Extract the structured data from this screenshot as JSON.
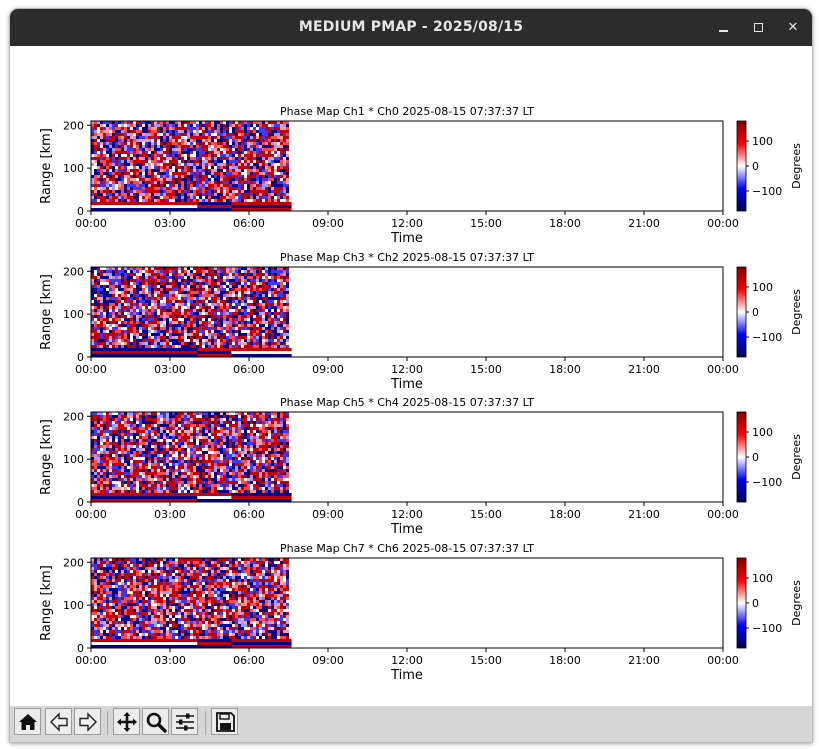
{
  "window": {
    "title": "MEDIUM PMAP - 2025/08/15"
  },
  "toolbar": {
    "buttons": [
      {
        "name": "home-button",
        "icon": "home-icon"
      },
      {
        "name": "back-button",
        "icon": "arrow-left-icon"
      },
      {
        "name": "forward-button",
        "icon": "arrow-right-icon"
      },
      {
        "name": "pan-button",
        "icon": "move-icon"
      },
      {
        "name": "zoom-button",
        "icon": "magnifier-icon"
      },
      {
        "name": "configure-subplots-button",
        "icon": "sliders-icon"
      },
      {
        "name": "save-button",
        "icon": "floppy-disk-icon"
      }
    ]
  },
  "colors": {
    "titlebar": "#2c2c2c",
    "positive": "#b40000",
    "negative": "#00008c",
    "toolbar": "#d6d6d6"
  },
  "chart_data": [
    {
      "type": "heatmap",
      "title": "Phase Map Ch1 * Ch0 2025-08-15 07:37:37 LT",
      "xlabel": "Time",
      "ylabel": "Range [km]",
      "x_ticks": [
        "00:00",
        "03:00",
        "06:00",
        "09:00",
        "12:00",
        "15:00",
        "18:00",
        "21:00",
        "00:00"
      ],
      "y_ticks": [
        0,
        100,
        200
      ],
      "ylim": [
        0,
        210
      ],
      "data_end_time": "07:37",
      "colorbar": {
        "label": "Degrees",
        "ticks": [
          100,
          0,
          -100
        ],
        "range": [
          -180,
          180
        ],
        "colormap": "seismic"
      }
    },
    {
      "type": "heatmap",
      "title": "Phase Map Ch3 * Ch2 2025-08-15 07:37:37 LT",
      "xlabel": "Time",
      "ylabel": "Range [km]",
      "x_ticks": [
        "00:00",
        "03:00",
        "06:00",
        "09:00",
        "12:00",
        "15:00",
        "18:00",
        "21:00",
        "00:00"
      ],
      "y_ticks": [
        0,
        100,
        200
      ],
      "ylim": [
        0,
        210
      ],
      "data_end_time": "07:37",
      "colorbar": {
        "label": "Degrees",
        "ticks": [
          100,
          0,
          -100
        ],
        "range": [
          -180,
          180
        ],
        "colormap": "seismic"
      }
    },
    {
      "type": "heatmap",
      "title": "Phase Map Ch5 * Ch4 2025-08-15 07:37:37 LT",
      "xlabel": "Time",
      "ylabel": "Range [km]",
      "x_ticks": [
        "00:00",
        "03:00",
        "06:00",
        "09:00",
        "12:00",
        "15:00",
        "18:00",
        "21:00",
        "00:00"
      ],
      "y_ticks": [
        0,
        100,
        200
      ],
      "ylim": [
        0,
        210
      ],
      "data_end_time": "07:37",
      "colorbar": {
        "label": "Degrees",
        "ticks": [
          100,
          0,
          -100
        ],
        "range": [
          -180,
          180
        ],
        "colormap": "seismic"
      }
    },
    {
      "type": "heatmap",
      "title": "Phase Map Ch7 * Ch6 2025-08-15 07:37:37 LT",
      "xlabel": "Time",
      "ylabel": "Range [km]",
      "x_ticks": [
        "00:00",
        "03:00",
        "06:00",
        "09:00",
        "12:00",
        "15:00",
        "18:00",
        "21:00",
        "00:00"
      ],
      "y_ticks": [
        0,
        100,
        200
      ],
      "ylim": [
        0,
        210
      ],
      "data_end_time": "07:37",
      "colorbar": {
        "label": "Degrees",
        "ticks": [
          100,
          0,
          -100
        ],
        "range": [
          -180,
          180
        ],
        "colormap": "seismic"
      }
    }
  ]
}
